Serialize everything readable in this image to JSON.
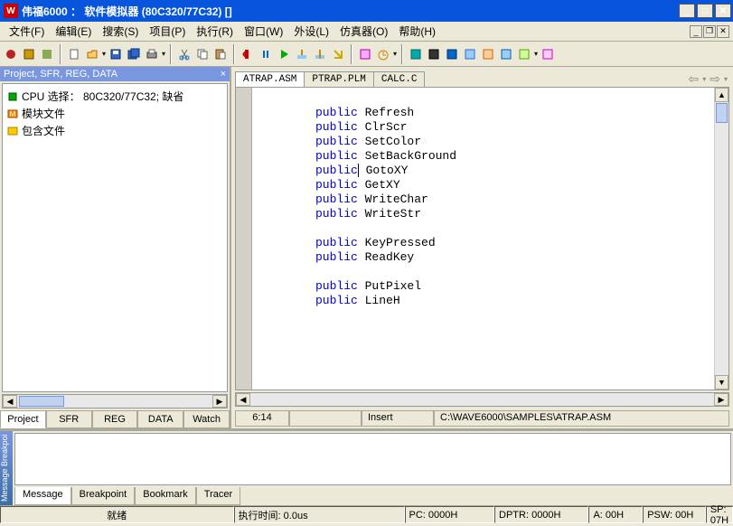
{
  "title": "伟福6000 ： 软件模拟器 (80C320/77C32) []",
  "menus": [
    "文件(F)",
    "编辑(E)",
    "搜索(S)",
    "项目(P)",
    "执行(R)",
    "窗口(W)",
    "外设(L)",
    "仿真器(O)",
    "帮助(H)"
  ],
  "left_panel": {
    "header": "Project, SFR, REG, DATA",
    "tree": [
      {
        "icon": "cpu",
        "label": "CPU 选择： 80C320/77C32;  缺省"
      },
      {
        "icon": "module",
        "label": "模块文件"
      },
      {
        "icon": "include",
        "label": "包含文件"
      }
    ],
    "tabs": [
      "Project",
      "SFR",
      "REG",
      "DATA",
      "Watch"
    ],
    "active_tab": 0
  },
  "editor": {
    "tabs": [
      "ATRAP.ASM",
      "PTRAP.PLM",
      "CALC.C"
    ],
    "active_tab": 0,
    "lines": [
      {
        "kw": "public",
        "id": "Refresh"
      },
      {
        "kw": "public",
        "id": "ClrScr"
      },
      {
        "kw": "public",
        "id": "SetColor"
      },
      {
        "kw": "public",
        "id": "SetBackGround"
      },
      {
        "kw": "public",
        "id": "GotoXY",
        "caret_after_kw": true
      },
      {
        "kw": "public",
        "id": "GetXY"
      },
      {
        "kw": "public",
        "id": "WriteChar"
      },
      {
        "kw": "public",
        "id": "WriteStr"
      },
      {
        "blank": true
      },
      {
        "kw": "public",
        "id": "KeyPressed"
      },
      {
        "kw": "public",
        "id": "ReadKey"
      },
      {
        "blank": true
      },
      {
        "kw": "public",
        "id": "PutPixel"
      },
      {
        "kw": "public",
        "id": "LineH"
      }
    ],
    "status": {
      "pos": "6:14",
      "mode": "Insert",
      "path": "C:\\WAVE6000\\SAMPLES\\ATRAP.ASM"
    }
  },
  "msg": {
    "side": "Message Breakpoi",
    "tabs": [
      "Message",
      "Breakpoint",
      "Bookmark",
      "Tracer"
    ],
    "active": 0
  },
  "status": {
    "ready": "就绪",
    "time": "执行时间: 0.0us",
    "pc": "PC: 0000H",
    "dptr": "DPTR: 0000H",
    "a": "A: 00H",
    "psw": "PSW: 00H",
    "sp": "SP: 07H"
  }
}
